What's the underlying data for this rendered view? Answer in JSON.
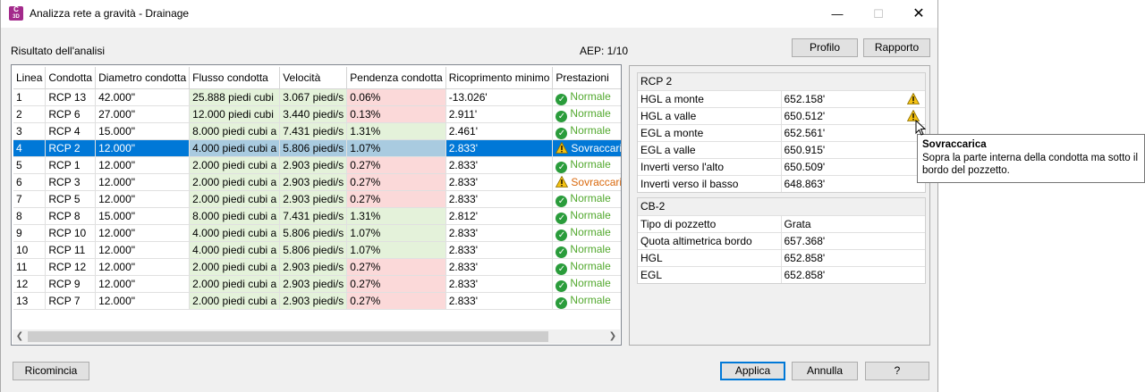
{
  "window": {
    "title": "Analizza rete a gravità - Drainage",
    "app_icon_text": "C",
    "app_icon_sub": "3D"
  },
  "header": {
    "result_label": "Risultato dell'analisi",
    "aep": "AEP: 1/10",
    "profile_button": "Profilo",
    "report_button": "Rapporto"
  },
  "grid": {
    "columns": [
      "Linea",
      "Condotta",
      "Diametro condotta",
      "Flusso condotta",
      "Velocità",
      "Pendenza condotta",
      "Ricoprimento minimo",
      "Prestazioni"
    ],
    "selected_index": 3,
    "rows": [
      {
        "line": "1",
        "pipe": "RCP 13",
        "diameter": "42.000\"",
        "flow": "25.888 piedi cubi",
        "velocity": "3.067 piedi/s",
        "slope": "0.06%",
        "cover": "-13.026'",
        "status": "Normale",
        "flow_state": "ok",
        "vel_state": "ok",
        "slope_state": "bad",
        "status_state": "ok"
      },
      {
        "line": "2",
        "pipe": "RCP 6",
        "diameter": "27.000\"",
        "flow": "12.000 piedi cubi",
        "velocity": "3.440 piedi/s",
        "slope": "0.13%",
        "cover": "2.911'",
        "status": "Normale",
        "flow_state": "ok",
        "vel_state": "ok",
        "slope_state": "bad",
        "status_state": "ok"
      },
      {
        "line": "3",
        "pipe": "RCP 4",
        "diameter": "15.000\"",
        "flow": "8.000 piedi cubi a",
        "velocity": "7.431 piedi/s",
        "slope": "1.31%",
        "cover": "2.461'",
        "status": "Normale",
        "flow_state": "ok",
        "vel_state": "ok",
        "slope_state": "ok",
        "status_state": "ok"
      },
      {
        "line": "4",
        "pipe": "RCP 2",
        "diameter": "12.000\"",
        "flow": "4.000 piedi cubi a",
        "velocity": "5.806 piedi/s",
        "slope": "1.07%",
        "cover": "2.833'",
        "status": "Sovraccarica",
        "flow_state": "ok",
        "vel_state": "ok",
        "slope_state": "ok",
        "status_state": "warn"
      },
      {
        "line": "5",
        "pipe": "RCP 1",
        "diameter": "12.000\"",
        "flow": "2.000 piedi cubi a",
        "velocity": "2.903 piedi/s",
        "slope": "0.27%",
        "cover": "2.833'",
        "status": "Normale",
        "flow_state": "ok",
        "vel_state": "ok",
        "slope_state": "bad",
        "status_state": "ok"
      },
      {
        "line": "6",
        "pipe": "RCP 3",
        "diameter": "12.000\"",
        "flow": "2.000 piedi cubi a",
        "velocity": "2.903 piedi/s",
        "slope": "0.27%",
        "cover": "2.833'",
        "status": "Sovraccarica",
        "flow_state": "ok",
        "vel_state": "ok",
        "slope_state": "bad",
        "status_state": "warn"
      },
      {
        "line": "7",
        "pipe": "RCP 5",
        "diameter": "12.000\"",
        "flow": "2.000 piedi cubi a",
        "velocity": "2.903 piedi/s",
        "slope": "0.27%",
        "cover": "2.833'",
        "status": "Normale",
        "flow_state": "ok",
        "vel_state": "ok",
        "slope_state": "bad",
        "status_state": "ok"
      },
      {
        "line": "8",
        "pipe": "RCP 8",
        "diameter": "15.000\"",
        "flow": "8.000 piedi cubi a",
        "velocity": "7.431 piedi/s",
        "slope": "1.31%",
        "cover": "2.812'",
        "status": "Normale",
        "flow_state": "ok",
        "vel_state": "ok",
        "slope_state": "ok",
        "status_state": "ok"
      },
      {
        "line": "9",
        "pipe": "RCP 10",
        "diameter": "12.000\"",
        "flow": "4.000 piedi cubi a",
        "velocity": "5.806 piedi/s",
        "slope": "1.07%",
        "cover": "2.833'",
        "status": "Normale",
        "flow_state": "ok",
        "vel_state": "ok",
        "slope_state": "ok",
        "status_state": "ok"
      },
      {
        "line": "10",
        "pipe": "RCP 11",
        "diameter": "12.000\"",
        "flow": "4.000 piedi cubi a",
        "velocity": "5.806 piedi/s",
        "slope": "1.07%",
        "cover": "2.833'",
        "status": "Normale",
        "flow_state": "ok",
        "vel_state": "ok",
        "slope_state": "ok",
        "status_state": "ok"
      },
      {
        "line": "11",
        "pipe": "RCP 12",
        "diameter": "12.000\"",
        "flow": "2.000 piedi cubi a",
        "velocity": "2.903 piedi/s",
        "slope": "0.27%",
        "cover": "2.833'",
        "status": "Normale",
        "flow_state": "ok",
        "vel_state": "ok",
        "slope_state": "bad",
        "status_state": "ok"
      },
      {
        "line": "12",
        "pipe": "RCP 9",
        "diameter": "12.000\"",
        "flow": "2.000 piedi cubi a",
        "velocity": "2.903 piedi/s",
        "slope": "0.27%",
        "cover": "2.833'",
        "status": "Normale",
        "flow_state": "ok",
        "vel_state": "ok",
        "slope_state": "bad",
        "status_state": "ok"
      },
      {
        "line": "13",
        "pipe": "RCP 7",
        "diameter": "12.000\"",
        "flow": "2.000 piedi cubi a",
        "velocity": "2.903 piedi/s",
        "slope": "0.27%",
        "cover": "2.833'",
        "status": "Normale",
        "flow_state": "ok",
        "vel_state": "ok",
        "slope_state": "bad",
        "status_state": "ok"
      }
    ]
  },
  "details": {
    "pipe": {
      "title": "RCP 2",
      "rows": [
        {
          "label": "HGL a monte",
          "value": "652.158'",
          "warning": true
        },
        {
          "label": "HGL a valle",
          "value": "650.512'",
          "warning": true
        },
        {
          "label": "EGL a monte",
          "value": "652.561'",
          "warning": false
        },
        {
          "label": "EGL a valle",
          "value": "650.915'",
          "warning": false
        },
        {
          "label": "Inverti verso l'alto",
          "value": "650.509'",
          "warning": false
        },
        {
          "label": "Inverti verso il basso",
          "value": "648.863'",
          "warning": false
        }
      ]
    },
    "structure": {
      "title": "CB-2",
      "rows": [
        {
          "label": "Tipo di pozzetto",
          "value": "Grata"
        },
        {
          "label": "Quota altimetrica bordo",
          "value": "657.368'"
        },
        {
          "label": "HGL",
          "value": "652.858'"
        },
        {
          "label": "EGL",
          "value": "652.858'"
        }
      ]
    }
  },
  "tooltip": {
    "title": "Sovraccarica",
    "text": "Sopra la parte interna della condotta ma sotto il bordo del pozzetto."
  },
  "footer": {
    "restart_button": "Ricomincia",
    "apply_button": "Applica",
    "cancel_button": "Annulla",
    "help_button": "?"
  },
  "colors": {
    "accent": "#0078d7",
    "ok_cell": "#e4f2da",
    "bad_cell": "#fbd9d9",
    "ok_text": "#53a92f",
    "warn_text": "#d9680c"
  }
}
